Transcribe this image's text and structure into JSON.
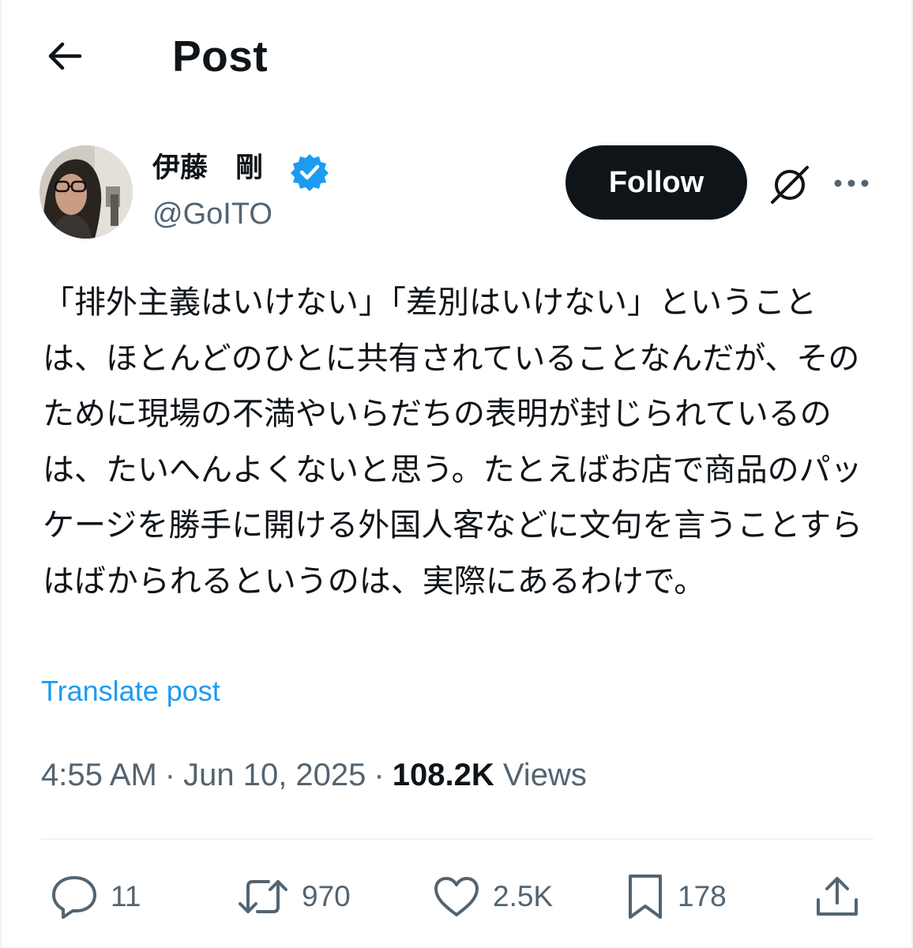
{
  "header": {
    "title": "Post"
  },
  "author": {
    "name": "伊藤　剛",
    "handle": "@GoITO",
    "verified": true
  },
  "follow_label": "Follow",
  "post": {
    "text": "「排外主義はいけない」「差別はいけない」ということは、ほとんどのひとに共有されていることなんだが、そのために現場の不満やいらだちの表明が封じられているのは、たいへんよくないと思う。たとえばお店で商品のパッケージを勝手に開ける外国人客などに文句を言うことすらはばかられるというのは、実際にあるわけで。",
    "translate_label": "Translate post"
  },
  "meta": {
    "time": "4:55 AM",
    "date": "Jun 10, 2025",
    "separator": "·",
    "views_count": "108.2K",
    "views_label": "Views"
  },
  "actions": {
    "replies": "11",
    "reposts": "970",
    "likes": "2.5K",
    "bookmarks": "178"
  },
  "colors": {
    "accent": "#1d9bf0",
    "text": "#0f1419",
    "secondary": "#536471",
    "divider": "#eff3f4"
  },
  "icons": [
    "back-arrow-icon",
    "verified-badge-icon",
    "grok-icon",
    "more-icon",
    "reply-icon",
    "repost-icon",
    "like-icon",
    "bookmark-icon",
    "share-icon"
  ]
}
